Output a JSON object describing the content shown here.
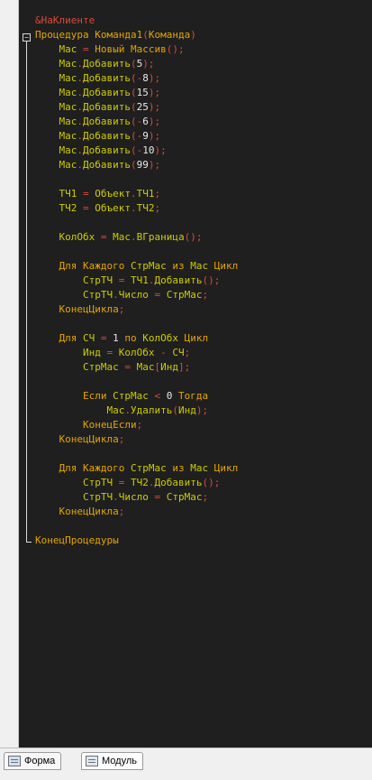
{
  "editor": {
    "lines": [
      [
        {
          "t": "&НаКлиенте",
          "c": "dir"
        }
      ],
      [
        {
          "t": "Процедура ",
          "c": "kw"
        },
        {
          "t": "Команда1",
          "c": "kw"
        },
        {
          "t": "(",
          "c": "op"
        },
        {
          "t": "Команда",
          "c": "kw"
        },
        {
          "t": ")",
          "c": "op"
        }
      ],
      [
        {
          "t": "    Мас ",
          "c": "id"
        },
        {
          "t": "=",
          "c": "op"
        },
        {
          "t": " Новый Массив",
          "c": "kw"
        },
        {
          "t": "();",
          "c": "op"
        }
      ],
      [
        {
          "t": "    Мас",
          "c": "id"
        },
        {
          "t": ".",
          "c": "op"
        },
        {
          "t": "Добавить",
          "c": "id"
        },
        {
          "t": "(",
          "c": "op"
        },
        {
          "t": "5",
          "c": "num"
        },
        {
          "t": ");",
          "c": "op"
        }
      ],
      [
        {
          "t": "    Мас",
          "c": "id"
        },
        {
          "t": ".",
          "c": "op"
        },
        {
          "t": "Добавить",
          "c": "id"
        },
        {
          "t": "(-",
          "c": "op"
        },
        {
          "t": "8",
          "c": "num"
        },
        {
          "t": ");",
          "c": "op"
        }
      ],
      [
        {
          "t": "    Мас",
          "c": "id"
        },
        {
          "t": ".",
          "c": "op"
        },
        {
          "t": "Добавить",
          "c": "id"
        },
        {
          "t": "(",
          "c": "op"
        },
        {
          "t": "15",
          "c": "num"
        },
        {
          "t": ");",
          "c": "op"
        }
      ],
      [
        {
          "t": "    Мас",
          "c": "id"
        },
        {
          "t": ".",
          "c": "op"
        },
        {
          "t": "Добавить",
          "c": "id"
        },
        {
          "t": "(",
          "c": "op"
        },
        {
          "t": "25",
          "c": "num"
        },
        {
          "t": ");",
          "c": "op"
        }
      ],
      [
        {
          "t": "    Мас",
          "c": "id"
        },
        {
          "t": ".",
          "c": "op"
        },
        {
          "t": "Добавить",
          "c": "id"
        },
        {
          "t": "(-",
          "c": "op"
        },
        {
          "t": "6",
          "c": "num"
        },
        {
          "t": ");",
          "c": "op"
        }
      ],
      [
        {
          "t": "    Мас",
          "c": "id"
        },
        {
          "t": ".",
          "c": "op"
        },
        {
          "t": "Добавить",
          "c": "id"
        },
        {
          "t": "(-",
          "c": "op"
        },
        {
          "t": "9",
          "c": "num"
        },
        {
          "t": ");",
          "c": "op"
        }
      ],
      [
        {
          "t": "    Мас",
          "c": "id"
        },
        {
          "t": ".",
          "c": "op"
        },
        {
          "t": "Добавить",
          "c": "id"
        },
        {
          "t": "(-",
          "c": "op"
        },
        {
          "t": "10",
          "c": "num"
        },
        {
          "t": ");",
          "c": "op"
        }
      ],
      [
        {
          "t": "    Мас",
          "c": "id"
        },
        {
          "t": ".",
          "c": "op"
        },
        {
          "t": "Добавить",
          "c": "id"
        },
        {
          "t": "(",
          "c": "op"
        },
        {
          "t": "99",
          "c": "num"
        },
        {
          "t": ");",
          "c": "op"
        }
      ],
      [],
      [
        {
          "t": "    ТЧ1 ",
          "c": "id"
        },
        {
          "t": "=",
          "c": "op"
        },
        {
          "t": " Объект",
          "c": "id"
        },
        {
          "t": ".",
          "c": "op"
        },
        {
          "t": "ТЧ1",
          "c": "id"
        },
        {
          "t": ";",
          "c": "op"
        }
      ],
      [
        {
          "t": "    ТЧ2 ",
          "c": "id"
        },
        {
          "t": "=",
          "c": "op"
        },
        {
          "t": " Объект",
          "c": "id"
        },
        {
          "t": ".",
          "c": "op"
        },
        {
          "t": "ТЧ2",
          "c": "id"
        },
        {
          "t": ";",
          "c": "op"
        }
      ],
      [],
      [
        {
          "t": "    КолОбх ",
          "c": "id"
        },
        {
          "t": "=",
          "c": "op"
        },
        {
          "t": " Мас",
          "c": "id"
        },
        {
          "t": ".",
          "c": "op"
        },
        {
          "t": "ВГраница",
          "c": "id"
        },
        {
          "t": "();",
          "c": "op"
        }
      ],
      [],
      [
        {
          "t": "    Для Каждого ",
          "c": "kw"
        },
        {
          "t": "СтрМас ",
          "c": "id"
        },
        {
          "t": "из ",
          "c": "kw"
        },
        {
          "t": "Мас ",
          "c": "id"
        },
        {
          "t": "Цикл",
          "c": "kw"
        }
      ],
      [
        {
          "t": "        СтрТЧ ",
          "c": "id"
        },
        {
          "t": "=",
          "c": "op"
        },
        {
          "t": " ТЧ1",
          "c": "id"
        },
        {
          "t": ".",
          "c": "op"
        },
        {
          "t": "Добавить",
          "c": "id"
        },
        {
          "t": "();",
          "c": "op"
        }
      ],
      [
        {
          "t": "        СтрТЧ",
          "c": "id"
        },
        {
          "t": ".",
          "c": "op"
        },
        {
          "t": "Число ",
          "c": "id"
        },
        {
          "t": "=",
          "c": "op"
        },
        {
          "t": " СтрМас",
          "c": "id"
        },
        {
          "t": ";",
          "c": "op"
        }
      ],
      [
        {
          "t": "    КонецЦикла",
          "c": "kw"
        },
        {
          "t": ";",
          "c": "op"
        }
      ],
      [],
      [
        {
          "t": "    Для ",
          "c": "kw"
        },
        {
          "t": "СЧ ",
          "c": "id"
        },
        {
          "t": "=",
          "c": "op"
        },
        {
          "t": " ",
          "c": "id"
        },
        {
          "t": "1",
          "c": "num"
        },
        {
          "t": " по ",
          "c": "kw"
        },
        {
          "t": "КолОбх ",
          "c": "id"
        },
        {
          "t": "Цикл",
          "c": "kw"
        }
      ],
      [
        {
          "t": "        Инд ",
          "c": "id"
        },
        {
          "t": "=",
          "c": "op"
        },
        {
          "t": " КолОбх ",
          "c": "id"
        },
        {
          "t": "-",
          "c": "op"
        },
        {
          "t": " СЧ",
          "c": "id"
        },
        {
          "t": ";",
          "c": "op"
        }
      ],
      [
        {
          "t": "        СтрМас ",
          "c": "id"
        },
        {
          "t": "=",
          "c": "op"
        },
        {
          "t": " Мас",
          "c": "id"
        },
        {
          "t": "[",
          "c": "op"
        },
        {
          "t": "Инд",
          "c": "id"
        },
        {
          "t": "];",
          "c": "op"
        }
      ],
      [],
      [
        {
          "t": "        Если ",
          "c": "kw"
        },
        {
          "t": "СтрМас ",
          "c": "id"
        },
        {
          "t": "<",
          "c": "op"
        },
        {
          "t": " ",
          "c": "id"
        },
        {
          "t": "0",
          "c": "num"
        },
        {
          "t": " Тогда",
          "c": "kw"
        }
      ],
      [
        {
          "t": "            Мас",
          "c": "id"
        },
        {
          "t": ".",
          "c": "op"
        },
        {
          "t": "Удалить",
          "c": "id"
        },
        {
          "t": "(",
          "c": "op"
        },
        {
          "t": "Инд",
          "c": "id"
        },
        {
          "t": ");",
          "c": "op"
        }
      ],
      [
        {
          "t": "        КонецЕсли",
          "c": "kw"
        },
        {
          "t": ";",
          "c": "op"
        }
      ],
      [
        {
          "t": "    КонецЦикла",
          "c": "kw"
        },
        {
          "t": ";",
          "c": "op"
        }
      ],
      [],
      [
        {
          "t": "    Для Каждого ",
          "c": "kw"
        },
        {
          "t": "СтрМас ",
          "c": "id"
        },
        {
          "t": "из ",
          "c": "kw"
        },
        {
          "t": "Мас ",
          "c": "id"
        },
        {
          "t": "Цикл",
          "c": "kw"
        }
      ],
      [
        {
          "t": "        СтрТЧ ",
          "c": "id"
        },
        {
          "t": "=",
          "c": "op"
        },
        {
          "t": " ТЧ2",
          "c": "id"
        },
        {
          "t": ".",
          "c": "op"
        },
        {
          "t": "Добавить",
          "c": "id"
        },
        {
          "t": "();",
          "c": "op"
        }
      ],
      [
        {
          "t": "        СтрТЧ",
          "c": "id"
        },
        {
          "t": ".",
          "c": "op"
        },
        {
          "t": "Число ",
          "c": "id"
        },
        {
          "t": "=",
          "c": "op"
        },
        {
          "t": " СтрМас",
          "c": "id"
        },
        {
          "t": ";",
          "c": "op"
        }
      ],
      [
        {
          "t": "    КонецЦикла",
          "c": "kw"
        },
        {
          "t": ";",
          "c": "op"
        }
      ],
      [],
      [
        {
          "t": "КонецПроцедуры",
          "c": "kw"
        }
      ]
    ],
    "fold_symbol": "−"
  },
  "tabs": [
    {
      "label": "Форма",
      "icon": "form-icon",
      "active": true
    },
    {
      "label": "Модуль",
      "icon": "module-icon",
      "active": false
    }
  ],
  "colors": {
    "background": "#1f1f1f",
    "keyword": "#e5a400",
    "identifier": "#cccc00",
    "operator": "#d94a3a",
    "number": "#e8e8e8"
  }
}
